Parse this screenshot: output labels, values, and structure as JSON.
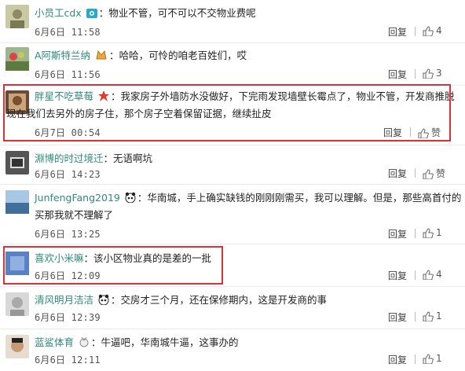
{
  "comments": [
    {
      "user": "小员工cdx",
      "badge": "eye-badge-icon",
      "text": "物业不管，可不可以不交物业费呢",
      "time": "6月6日 11:58",
      "reply": "回复",
      "likes": "4"
    },
    {
      "user": "A阿斯特兰纳",
      "badge": "gold-badge-icon",
      "text": "哈哈，可怜的咱老百姓们，哎",
      "time": "6月6日 11:56",
      "reply": "回复",
      "likes": "3"
    },
    {
      "user": "胖星不吃草莓",
      "badge": "star-badge-icon",
      "text1": "我家房子外墙防水没做好，下完雨发现墙壁长霉点了，物业不管，开发商推脱",
      "text2": "现在我们去另外的房子住，那个房子空着保留证据，继续扯皮",
      "time": "6月7日 00:54",
      "reply": "回复",
      "likes": "赞"
    },
    {
      "user": "淵博的时过境迁",
      "badge": "",
      "text": "无语啊坑",
      "time": "6月6日 14:23",
      "reply": "回复",
      "likes": "赞"
    },
    {
      "user": "JunfengFang2019",
      "badge": "panda-badge-icon",
      "text1": "华南城，手上确实缺钱的刚刚刚需买，我可以理解。但是，那些高首付的",
      "text2": "买那我就不理解了",
      "time": "6月6日 13:25",
      "reply": "回复",
      "likes": "1"
    },
    {
      "user": "喜欢小米嘛",
      "badge": "",
      "text": "该小区物业真的是差的一批",
      "time": "6月6日 12:09",
      "reply": "回复",
      "likes": "4"
    },
    {
      "user": "清风明月洁洁",
      "badge": "panda-badge-icon",
      "text": "交房才三个月，还在保修期内，这是开发商的事",
      "time": "6月6日 12:39",
      "reply": "回复",
      "likes": "1"
    },
    {
      "user": "蓝鲨体育",
      "badge": "medal-badge-icon",
      "text": "牛逼吧，华南城牛逼，这事办的",
      "time": "6月6日 12:11",
      "reply": "回复",
      "likes": "1"
    }
  ],
  "colors": {
    "username": "#2f8b7b",
    "highlight": "#d9323b",
    "divider": "#ececec"
  },
  "colon": "："
}
